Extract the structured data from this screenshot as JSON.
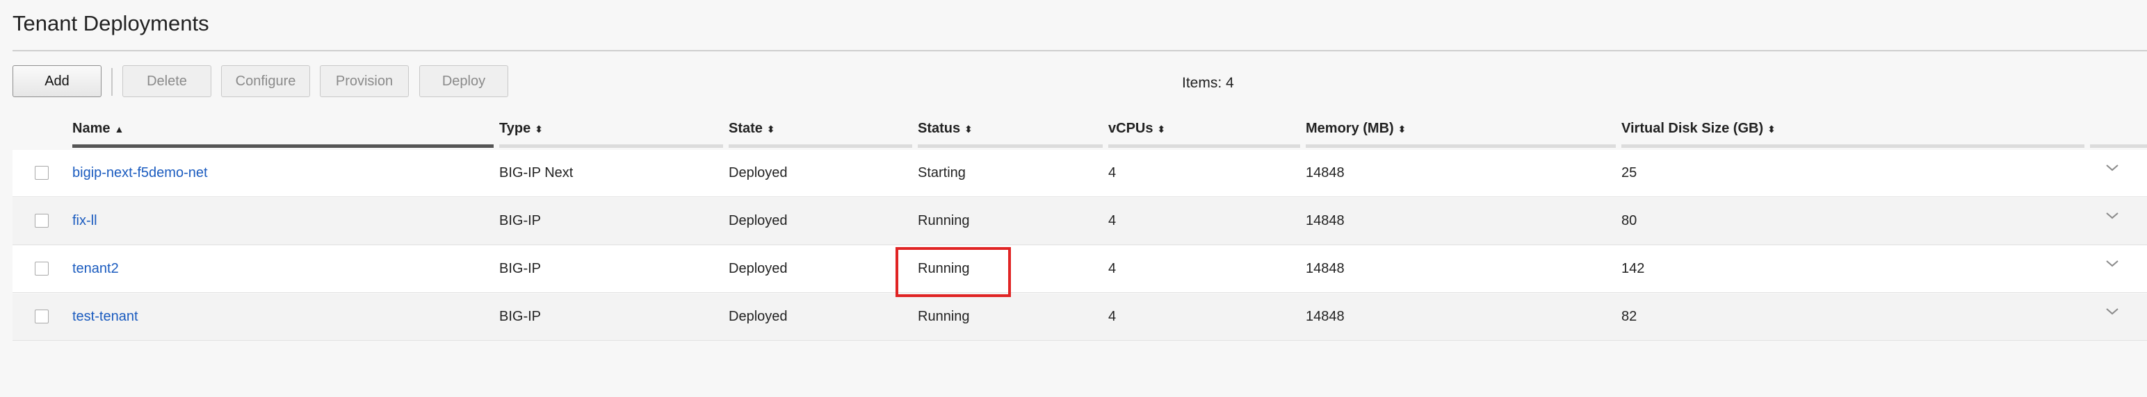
{
  "page": {
    "title": "Tenant Deployments"
  },
  "toolbar": {
    "add": "Add",
    "delete": "Delete",
    "configure": "Configure",
    "provision": "Provision",
    "deploy": "Deploy",
    "items_count": "Items: 4"
  },
  "table": {
    "columns": [
      {
        "label": "Name",
        "sort": "asc"
      },
      {
        "label": "Type",
        "sort": "none"
      },
      {
        "label": "State",
        "sort": "none"
      },
      {
        "label": "Status",
        "sort": "none"
      },
      {
        "label": "vCPUs",
        "sort": "none"
      },
      {
        "label": "Memory (MB)",
        "sort": "none"
      },
      {
        "label": "Virtual Disk Size (GB)",
        "sort": "none"
      }
    ],
    "sort_icons": {
      "asc": "▲",
      "none": "⬍"
    },
    "rows": [
      {
        "name": "bigip-next-f5demo-net",
        "type": "BIG-IP Next",
        "state": "Deployed",
        "status": "Starting",
        "vcpus": "4",
        "memory": "14848",
        "disk": "25"
      },
      {
        "name": "fix-ll",
        "type": "BIG-IP",
        "state": "Deployed",
        "status": "Running",
        "vcpus": "4",
        "memory": "14848",
        "disk": "80"
      },
      {
        "name": "tenant2",
        "type": "BIG-IP",
        "state": "Deployed",
        "status": "Running",
        "vcpus": "4",
        "memory": "14848",
        "disk": "142"
      },
      {
        "name": "test-tenant",
        "type": "BIG-IP",
        "state": "Deployed",
        "status": "Running",
        "vcpus": "4",
        "memory": "14848",
        "disk": "82"
      }
    ]
  },
  "colors": {
    "link": "#1a5bbf",
    "highlight": "#e02424"
  },
  "icons": {
    "row_expand": "chevron-down-icon",
    "checkbox": "checkbox"
  }
}
